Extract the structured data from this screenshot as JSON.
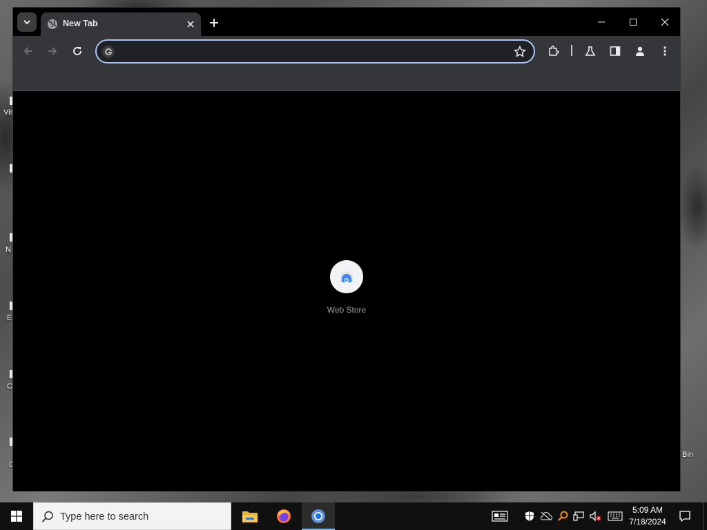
{
  "desktop": {
    "icons": [
      {
        "label": "Vis"
      },
      {
        "label": "N"
      },
      {
        "label": "E"
      },
      {
        "label": "C"
      },
      {
        "label": "D"
      },
      {
        "label": "Bin"
      }
    ]
  },
  "browser": {
    "tabs": [
      {
        "title": "New Tab",
        "favicon": "globe-icon"
      }
    ],
    "toolbar": {
      "omnibox_value": "",
      "omnibox_placeholder": ""
    },
    "new_tab_page": {
      "shortcuts": [
        {
          "label": "Web Store",
          "icon": "chrome-web-store-icon"
        }
      ]
    }
  },
  "taskbar": {
    "search_placeholder": "Type here to search",
    "apps": [
      {
        "name": "File Explorer",
        "icon": "file-explorer-icon"
      },
      {
        "name": "Firefox",
        "icon": "firefox-icon"
      },
      {
        "name": "Chrome",
        "icon": "chrome-icon",
        "active": true
      }
    ],
    "clock": {
      "time": "5:09 AM",
      "date": "7/18/2024"
    }
  },
  "colors": {
    "omnibox_focus_border": "#a8c7fa",
    "toolbar_bg": "#35363a",
    "taskbar_bg": "#101010",
    "active_app_indicator": "#76b9ed"
  }
}
